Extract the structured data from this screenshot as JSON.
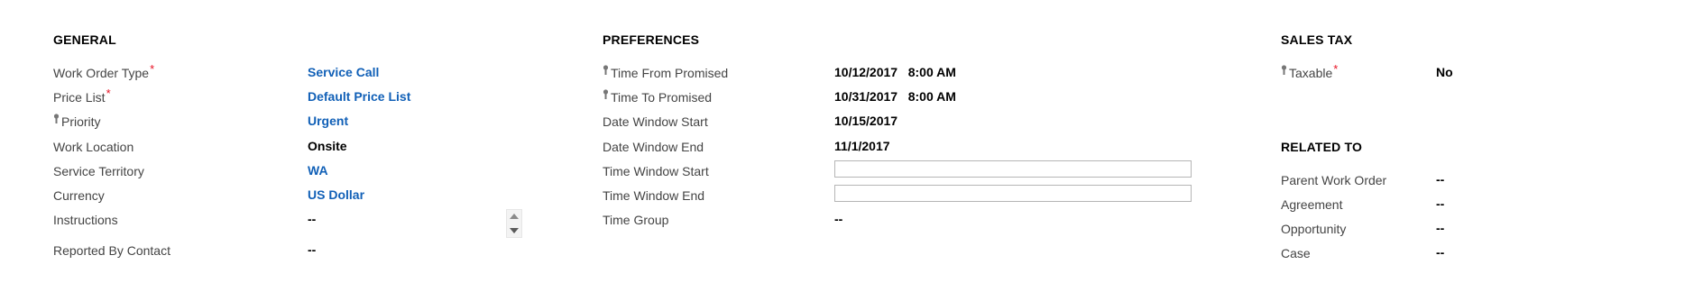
{
  "general": {
    "title": "GENERAL",
    "fields": [
      {
        "label": "Work Order Type",
        "value": "Service Call",
        "required": "*"
      },
      {
        "label": "Price List",
        "value": "Default Price List",
        "required": "*"
      },
      {
        "label": "Priority",
        "value": "Urgent",
        "lock_icon": "lock-icon"
      },
      {
        "label": "Work Location",
        "value": "Onsite"
      },
      {
        "label": "Service Territory",
        "value": "WA"
      },
      {
        "label": "Currency",
        "value": "US Dollar"
      },
      {
        "label": "Instructions",
        "value": "--"
      },
      {
        "label": "Reported By Contact",
        "value": "--"
      }
    ]
  },
  "preferences": {
    "title": "PREFERENCES",
    "fields": [
      {
        "label": "Time From Promised",
        "value": "10/12/2017   8:00 AM",
        "lock_icon": "lock-icon"
      },
      {
        "label": "Time To Promised",
        "value": "10/31/2017   8:00 AM",
        "lock_icon": "lock-icon"
      },
      {
        "label": "Date Window Start",
        "value": "10/15/2017"
      },
      {
        "label": "Date Window End",
        "value": "11/1/2017"
      },
      {
        "label": "Time Window Start",
        "value": ""
      },
      {
        "label": "Time Window End",
        "value": ""
      },
      {
        "label": "Time Group",
        "value": "--"
      }
    ]
  },
  "sales_tax": {
    "title": "SALES TAX",
    "fields": [
      {
        "label": "Taxable",
        "value": "No",
        "required": "*",
        "lock_icon": "lock-icon"
      }
    ]
  },
  "related_to": {
    "title": "RELATED TO",
    "fields": [
      {
        "label": "Parent Work Order",
        "value": "--"
      },
      {
        "label": "Agreement",
        "value": "--"
      },
      {
        "label": "Opportunity",
        "value": "--"
      },
      {
        "label": "Case",
        "value": "--"
      }
    ]
  },
  "colors": {
    "link": "#1160b7",
    "required": "#e81123",
    "label": "#444444",
    "value": "#000000"
  }
}
